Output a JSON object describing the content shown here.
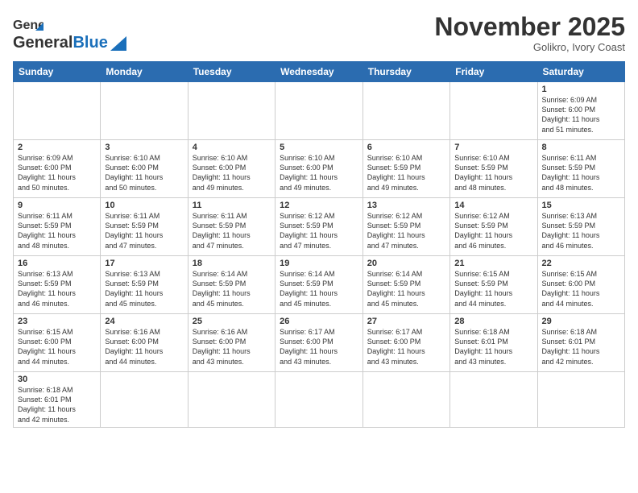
{
  "header": {
    "logo_general": "General",
    "logo_blue": "Blue",
    "month_title": "November 2025",
    "location": "Golikro, Ivory Coast"
  },
  "days_of_week": [
    "Sunday",
    "Monday",
    "Tuesday",
    "Wednesday",
    "Thursday",
    "Friday",
    "Saturday"
  ],
  "weeks": [
    [
      {
        "day": "",
        "info": ""
      },
      {
        "day": "",
        "info": ""
      },
      {
        "day": "",
        "info": ""
      },
      {
        "day": "",
        "info": ""
      },
      {
        "day": "",
        "info": ""
      },
      {
        "day": "",
        "info": ""
      },
      {
        "day": "1",
        "info": "Sunrise: 6:09 AM\nSunset: 6:00 PM\nDaylight: 11 hours\nand 51 minutes."
      }
    ],
    [
      {
        "day": "2",
        "info": "Sunrise: 6:09 AM\nSunset: 6:00 PM\nDaylight: 11 hours\nand 50 minutes."
      },
      {
        "day": "3",
        "info": "Sunrise: 6:10 AM\nSunset: 6:00 PM\nDaylight: 11 hours\nand 50 minutes."
      },
      {
        "day": "4",
        "info": "Sunrise: 6:10 AM\nSunset: 6:00 PM\nDaylight: 11 hours\nand 49 minutes."
      },
      {
        "day": "5",
        "info": "Sunrise: 6:10 AM\nSunset: 6:00 PM\nDaylight: 11 hours\nand 49 minutes."
      },
      {
        "day": "6",
        "info": "Sunrise: 6:10 AM\nSunset: 5:59 PM\nDaylight: 11 hours\nand 49 minutes."
      },
      {
        "day": "7",
        "info": "Sunrise: 6:10 AM\nSunset: 5:59 PM\nDaylight: 11 hours\nand 48 minutes."
      },
      {
        "day": "8",
        "info": "Sunrise: 6:11 AM\nSunset: 5:59 PM\nDaylight: 11 hours\nand 48 minutes."
      }
    ],
    [
      {
        "day": "9",
        "info": "Sunrise: 6:11 AM\nSunset: 5:59 PM\nDaylight: 11 hours\nand 48 minutes."
      },
      {
        "day": "10",
        "info": "Sunrise: 6:11 AM\nSunset: 5:59 PM\nDaylight: 11 hours\nand 47 minutes."
      },
      {
        "day": "11",
        "info": "Sunrise: 6:11 AM\nSunset: 5:59 PM\nDaylight: 11 hours\nand 47 minutes."
      },
      {
        "day": "12",
        "info": "Sunrise: 6:12 AM\nSunset: 5:59 PM\nDaylight: 11 hours\nand 47 minutes."
      },
      {
        "day": "13",
        "info": "Sunrise: 6:12 AM\nSunset: 5:59 PM\nDaylight: 11 hours\nand 47 minutes."
      },
      {
        "day": "14",
        "info": "Sunrise: 6:12 AM\nSunset: 5:59 PM\nDaylight: 11 hours\nand 46 minutes."
      },
      {
        "day": "15",
        "info": "Sunrise: 6:13 AM\nSunset: 5:59 PM\nDaylight: 11 hours\nand 46 minutes."
      }
    ],
    [
      {
        "day": "16",
        "info": "Sunrise: 6:13 AM\nSunset: 5:59 PM\nDaylight: 11 hours\nand 46 minutes."
      },
      {
        "day": "17",
        "info": "Sunrise: 6:13 AM\nSunset: 5:59 PM\nDaylight: 11 hours\nand 45 minutes."
      },
      {
        "day": "18",
        "info": "Sunrise: 6:14 AM\nSunset: 5:59 PM\nDaylight: 11 hours\nand 45 minutes."
      },
      {
        "day": "19",
        "info": "Sunrise: 6:14 AM\nSunset: 5:59 PM\nDaylight: 11 hours\nand 45 minutes."
      },
      {
        "day": "20",
        "info": "Sunrise: 6:14 AM\nSunset: 5:59 PM\nDaylight: 11 hours\nand 45 minutes."
      },
      {
        "day": "21",
        "info": "Sunrise: 6:15 AM\nSunset: 5:59 PM\nDaylight: 11 hours\nand 44 minutes."
      },
      {
        "day": "22",
        "info": "Sunrise: 6:15 AM\nSunset: 6:00 PM\nDaylight: 11 hours\nand 44 minutes."
      }
    ],
    [
      {
        "day": "23",
        "info": "Sunrise: 6:15 AM\nSunset: 6:00 PM\nDaylight: 11 hours\nand 44 minutes."
      },
      {
        "day": "24",
        "info": "Sunrise: 6:16 AM\nSunset: 6:00 PM\nDaylight: 11 hours\nand 44 minutes."
      },
      {
        "day": "25",
        "info": "Sunrise: 6:16 AM\nSunset: 6:00 PM\nDaylight: 11 hours\nand 43 minutes."
      },
      {
        "day": "26",
        "info": "Sunrise: 6:17 AM\nSunset: 6:00 PM\nDaylight: 11 hours\nand 43 minutes."
      },
      {
        "day": "27",
        "info": "Sunrise: 6:17 AM\nSunset: 6:00 PM\nDaylight: 11 hours\nand 43 minutes."
      },
      {
        "day": "28",
        "info": "Sunrise: 6:18 AM\nSunset: 6:01 PM\nDaylight: 11 hours\nand 43 minutes."
      },
      {
        "day": "29",
        "info": "Sunrise: 6:18 AM\nSunset: 6:01 PM\nDaylight: 11 hours\nand 42 minutes."
      }
    ],
    [
      {
        "day": "30",
        "info": "Sunrise: 6:18 AM\nSunset: 6:01 PM\nDaylight: 11 hours\nand 42 minutes."
      },
      {
        "day": "",
        "info": ""
      },
      {
        "day": "",
        "info": ""
      },
      {
        "day": "",
        "info": ""
      },
      {
        "day": "",
        "info": ""
      },
      {
        "day": "",
        "info": ""
      },
      {
        "day": "",
        "info": ""
      }
    ]
  ]
}
